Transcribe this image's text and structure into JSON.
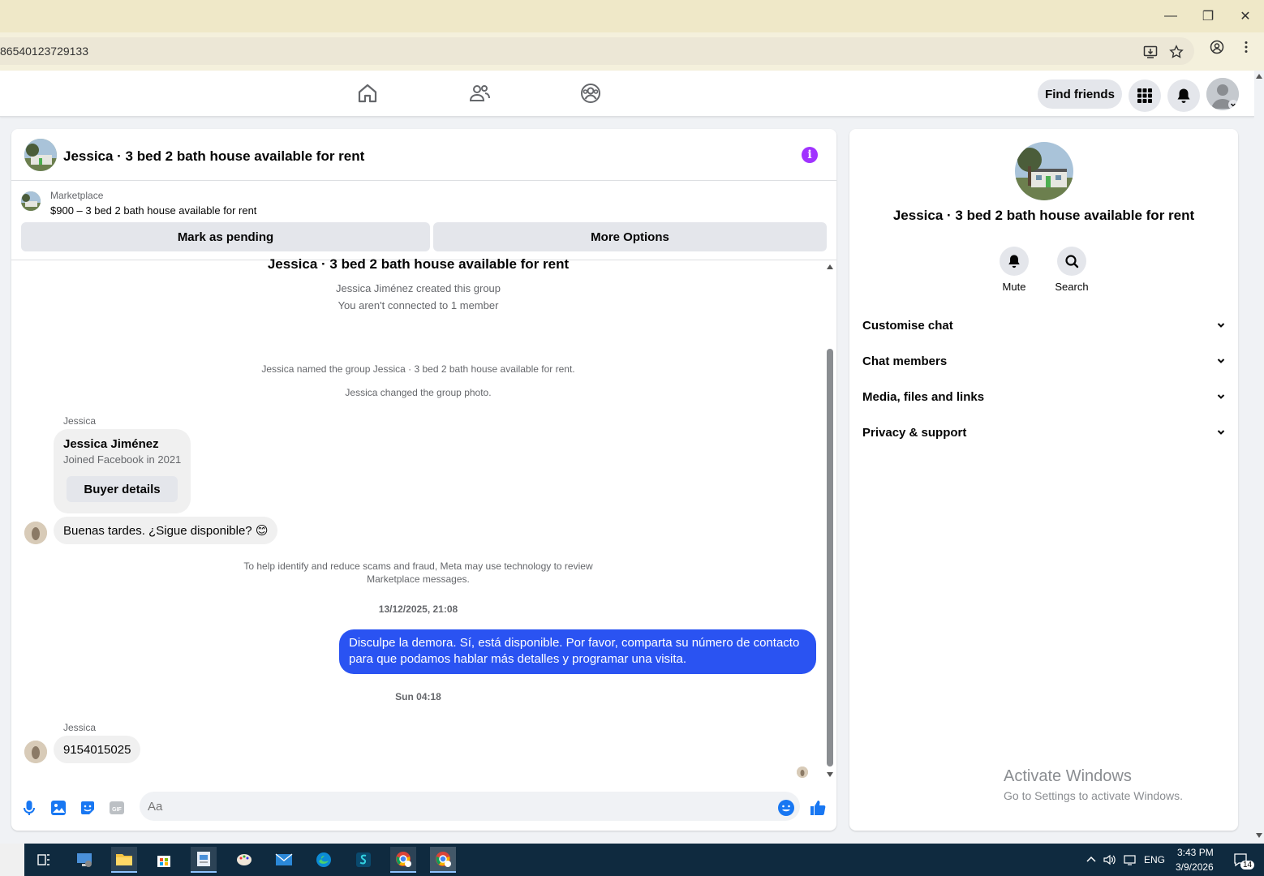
{
  "browser": {
    "url": "86540123729133",
    "window_controls": {
      "minimize": "—",
      "restore": "❐",
      "close": "✕"
    }
  },
  "nav": {
    "find_friends": "Find friends"
  },
  "chat": {
    "title": "Jessica · 3 bed 2 bath house available for rent",
    "marketplace": {
      "label": "Marketplace",
      "price_line": "$900 – 3 bed 2 bath house available for rent",
      "mark_pending": "Mark as pending",
      "more_options": "More Options"
    },
    "group_title": "Jessica · 3 bed 2 bath house available for rent",
    "created_by": "Jessica Jiménez created this group",
    "not_connected": "You aren't connected to 1 member",
    "named_group": "Jessica named the group Jessica · 3 bed 2 bath house available for rent.",
    "changed_photo": "Jessica changed the group photo.",
    "sender_1": "Jessica",
    "card": {
      "name": "Jessica Jiménez",
      "joined": "Joined Facebook in 2021",
      "button": "Buyer details"
    },
    "msg_1": "Buenas tardes. ¿Sigue disponible? 😊",
    "scam_notice_1": "To help identify and reduce scams and fraud, Meta may use technology to review",
    "scam_notice_2": "Marketplace messages.",
    "timestamp_1": "13/12/2025, 21:08",
    "msg_out": "Disculpe la demora. Sí, está disponible. Por favor, comparta su número de contacto para que podamos hablar más detalles y programar una visita.",
    "timestamp_2": "Sun 04:18",
    "sender_2": "Jessica",
    "msg_2": "9154015025",
    "composer_placeholder": "Aa"
  },
  "right_panel": {
    "title": "Jessica · 3 bed 2 bath house available for rent",
    "mute": "Mute",
    "search": "Search",
    "sections": [
      "Customise chat",
      "Chat members",
      "Media, files and links",
      "Privacy & support"
    ]
  },
  "watermark": {
    "line1": "Activate Windows",
    "line2": "Go to Settings to activate Windows."
  },
  "taskbar": {
    "lang": "ENG",
    "time": "3:43 PM",
    "date": "3/9/2026",
    "notifications": "14"
  },
  "colors": {
    "accent": "#2a53f2",
    "info": "#a033ff",
    "fb_blue": "#1877f2"
  }
}
